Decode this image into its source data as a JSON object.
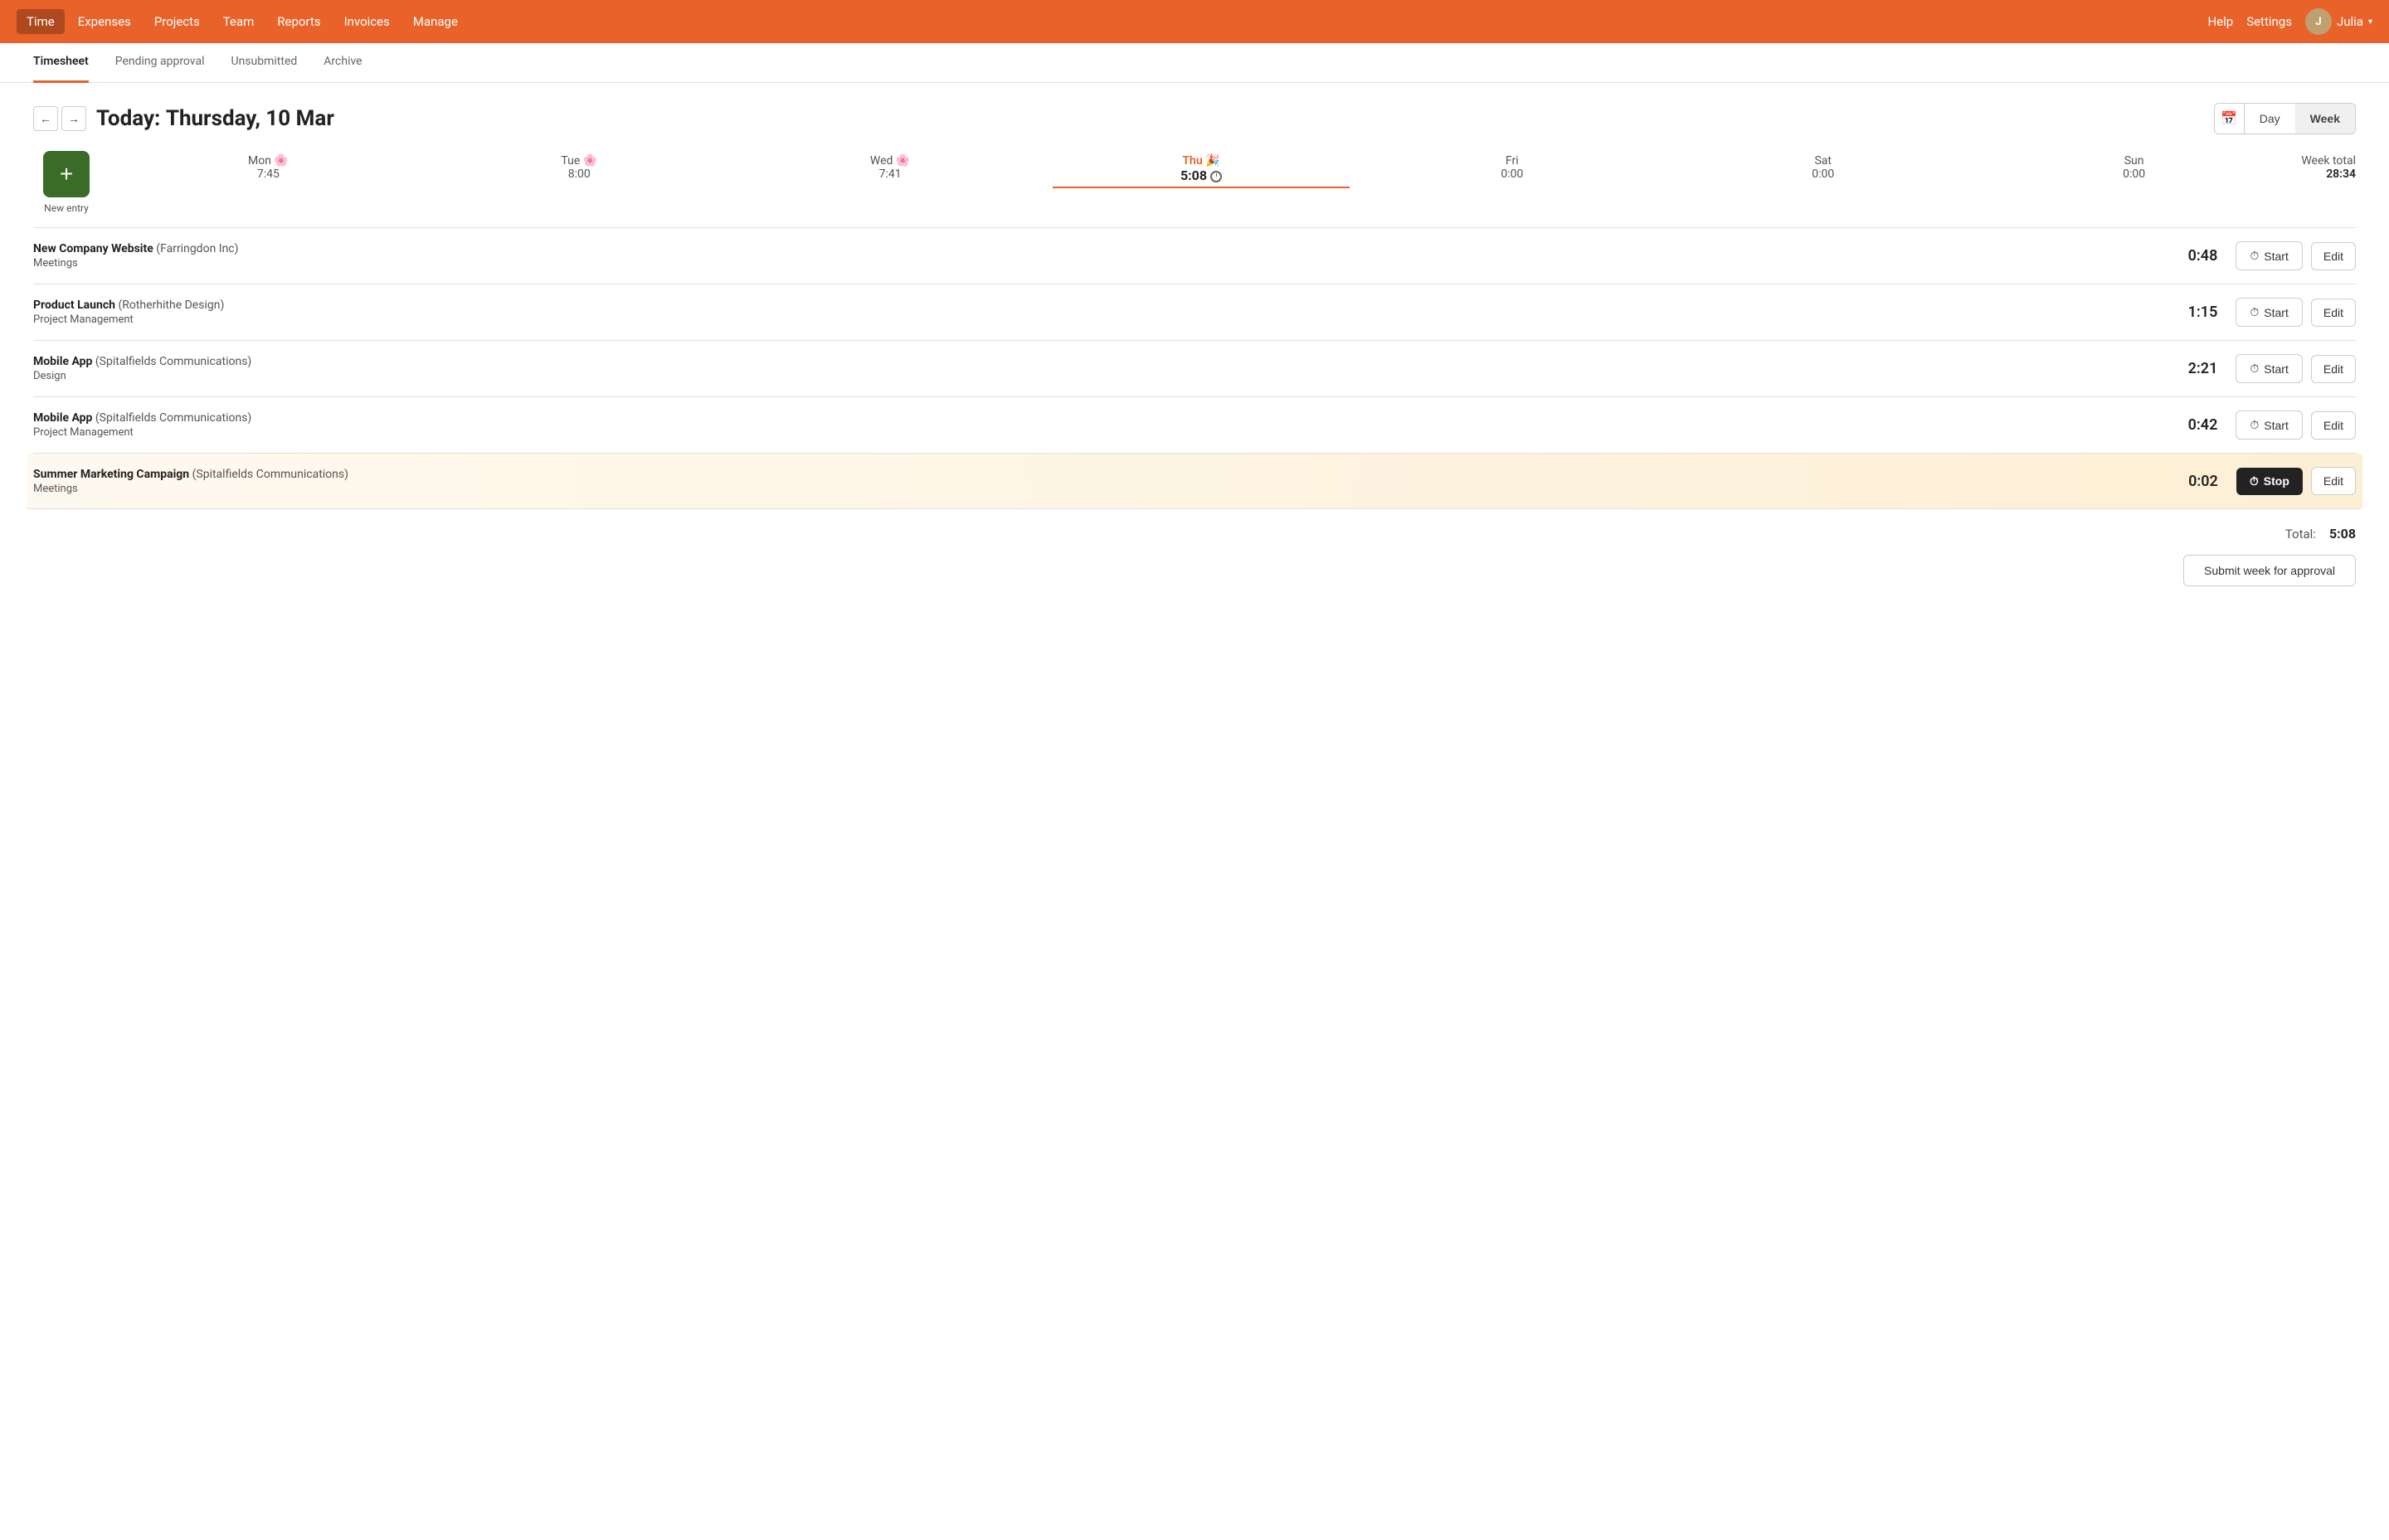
{
  "nav": {
    "items": [
      {
        "id": "time",
        "label": "Time",
        "active": true
      },
      {
        "id": "expenses",
        "label": "Expenses",
        "active": false
      },
      {
        "id": "projects",
        "label": "Projects",
        "active": false
      },
      {
        "id": "team",
        "label": "Team",
        "active": false
      },
      {
        "id": "reports",
        "label": "Reports",
        "active": false
      },
      {
        "id": "invoices",
        "label": "Invoices",
        "active": false
      },
      {
        "id": "manage",
        "label": "Manage",
        "active": false
      }
    ],
    "help": "Help",
    "settings": "Settings",
    "user": "Julia"
  },
  "tabs": [
    {
      "id": "timesheet",
      "label": "Timesheet",
      "active": true
    },
    {
      "id": "pending",
      "label": "Pending approval",
      "active": false
    },
    {
      "id": "unsubmitted",
      "label": "Unsubmitted",
      "active": false
    },
    {
      "id": "archive",
      "label": "Archive",
      "active": false
    }
  ],
  "header": {
    "today_prefix": "Today:",
    "today_date": "Thursday, 10 Mar",
    "day_label": "Day",
    "week_label": "Week"
  },
  "week": {
    "days": [
      {
        "id": "mon",
        "name": "Mon",
        "emoji": "🌸",
        "hours": "7:45",
        "current": false
      },
      {
        "id": "tue",
        "name": "Tue",
        "emoji": "🌸",
        "hours": "8:00",
        "current": false
      },
      {
        "id": "wed",
        "name": "Wed",
        "emoji": "🌸",
        "hours": "7:41",
        "current": false
      },
      {
        "id": "thu",
        "name": "Thu",
        "emoji": "🎉",
        "hours": "5:08",
        "current": true
      },
      {
        "id": "fri",
        "name": "Fri",
        "emoji": "",
        "hours": "0:00",
        "current": false
      },
      {
        "id": "sat",
        "name": "Sat",
        "emoji": "",
        "hours": "0:00",
        "current": false
      },
      {
        "id": "sun",
        "name": "Sun",
        "emoji": "",
        "hours": "0:00",
        "current": false
      }
    ],
    "total_label": "Week total",
    "total_hours": "28:34"
  },
  "new_entry_label": "New entry",
  "entries": [
    {
      "id": "entry1",
      "project": "New Company Website",
      "client": "(Farringdon Inc)",
      "task": "Meetings",
      "time": "0:48",
      "running": false,
      "start_label": "Start",
      "edit_label": "Edit"
    },
    {
      "id": "entry2",
      "project": "Product Launch",
      "client": "(Rotherhithe Design)",
      "task": "Project Management",
      "time": "1:15",
      "running": false,
      "start_label": "Start",
      "edit_label": "Edit"
    },
    {
      "id": "entry3",
      "project": "Mobile App",
      "client": "(Spitalfields Communications)",
      "task": "Design",
      "time": "2:21",
      "running": false,
      "start_label": "Start",
      "edit_label": "Edit"
    },
    {
      "id": "entry4",
      "project": "Mobile App",
      "client": "(Spitalfields Communications)",
      "task": "Project Management",
      "time": "0:42",
      "running": false,
      "start_label": "Start",
      "edit_label": "Edit"
    },
    {
      "id": "entry5",
      "project": "Summer Marketing Campaign",
      "client": "(Spitalfields Communications)",
      "task": "Meetings",
      "time": "0:02",
      "running": true,
      "stop_label": "Stop",
      "edit_label": "Edit"
    }
  ],
  "total": {
    "label": "Total:",
    "value": "5:08"
  },
  "submit_label": "Submit week for approval"
}
